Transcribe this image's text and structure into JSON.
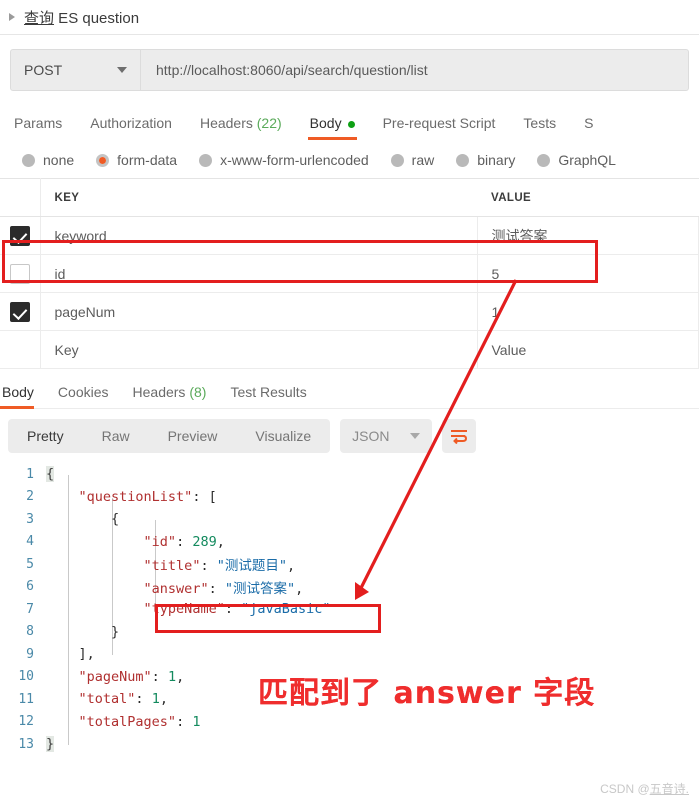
{
  "request": {
    "title_cn": "查询",
    "title_rest": " ES question",
    "method": "POST",
    "url": "http://localhost:8060/api/search/question/list",
    "tabs": [
      {
        "label": "Params",
        "active": false,
        "count": ""
      },
      {
        "label": "Authorization",
        "active": false,
        "count": ""
      },
      {
        "label": "Headers",
        "active": false,
        "count": "(22)"
      },
      {
        "label": "Body",
        "active": true,
        "count": ""
      },
      {
        "label": "Pre-request Script",
        "active": false,
        "count": ""
      },
      {
        "label": "Tests",
        "active": false,
        "count": ""
      },
      {
        "label": "S",
        "active": false,
        "count": ""
      }
    ],
    "body_types": [
      {
        "label": "none",
        "selected": false
      },
      {
        "label": "form-data",
        "selected": true
      },
      {
        "label": "x-www-form-urlencoded",
        "selected": false
      },
      {
        "label": "raw",
        "selected": false
      },
      {
        "label": "binary",
        "selected": false
      },
      {
        "label": "GraphQL",
        "selected": false
      }
    ],
    "table": {
      "headers": {
        "key": "KEY",
        "value": "VALUE"
      },
      "rows": [
        {
          "checked": true,
          "key": "keyword",
          "value": "测试答案",
          "placeholder": false
        },
        {
          "checked": false,
          "key": "id",
          "value": "5",
          "placeholder": false
        },
        {
          "checked": true,
          "key": "pageNum",
          "value": "1",
          "placeholder": false
        },
        {
          "checked": false,
          "key": "Key",
          "value": "Value",
          "placeholder": true
        }
      ]
    }
  },
  "response": {
    "tabs": [
      {
        "label": "Body",
        "active": true,
        "count": ""
      },
      {
        "label": "Cookies",
        "active": false,
        "count": ""
      },
      {
        "label": "Headers",
        "active": false,
        "count": "(8)"
      },
      {
        "label": "Test Results",
        "active": false,
        "count": ""
      }
    ],
    "view_modes": [
      {
        "label": "Pretty",
        "active": true
      },
      {
        "label": "Raw",
        "active": false
      },
      {
        "label": "Preview",
        "active": false
      },
      {
        "label": "Visualize",
        "active": false
      }
    ],
    "format": "JSON",
    "wrap_icon": "wrap-lines-icon",
    "code_lines": [
      {
        "n": "1",
        "segments": [
          {
            "t": "{",
            "c": "brc"
          }
        ]
      },
      {
        "n": "2",
        "segments": [
          {
            "t": "    ",
            "c": "pun"
          },
          {
            "t": "\"questionList\"",
            "c": "k"
          },
          {
            "t": ": [",
            "c": "pun"
          }
        ]
      },
      {
        "n": "3",
        "segments": [
          {
            "t": "        {",
            "c": "pun"
          }
        ]
      },
      {
        "n": "4",
        "segments": [
          {
            "t": "            ",
            "c": "pun"
          },
          {
            "t": "\"id\"",
            "c": "k"
          },
          {
            "t": ": ",
            "c": "pun"
          },
          {
            "t": "289",
            "c": "num"
          },
          {
            "t": ",",
            "c": "pun"
          }
        ]
      },
      {
        "n": "5",
        "segments": [
          {
            "t": "            ",
            "c": "pun"
          },
          {
            "t": "\"title\"",
            "c": "k"
          },
          {
            "t": ": ",
            "c": "pun"
          },
          {
            "t": "\"测试题目\"",
            "c": "str"
          },
          {
            "t": ",",
            "c": "pun"
          }
        ]
      },
      {
        "n": "6",
        "segments": [
          {
            "t": "            ",
            "c": "pun"
          },
          {
            "t": "\"answer\"",
            "c": "k"
          },
          {
            "t": ": ",
            "c": "pun"
          },
          {
            "t": "\"测试答案\"",
            "c": "str"
          },
          {
            "t": ",",
            "c": "pun"
          }
        ]
      },
      {
        "n": "7",
        "segments": [
          {
            "t": "            ",
            "c": "pun"
          },
          {
            "t": "\"typeName\"",
            "c": "k"
          },
          {
            "t": ": ",
            "c": "pun"
          },
          {
            "t": "\"javaBasic\"",
            "c": "str"
          }
        ]
      },
      {
        "n": "8",
        "segments": [
          {
            "t": "        }",
            "c": "pun"
          }
        ]
      },
      {
        "n": "9",
        "segments": [
          {
            "t": "    ],",
            "c": "pun"
          }
        ]
      },
      {
        "n": "10",
        "segments": [
          {
            "t": "    ",
            "c": "pun"
          },
          {
            "t": "\"pageNum\"",
            "c": "k"
          },
          {
            "t": ": ",
            "c": "pun"
          },
          {
            "t": "1",
            "c": "num"
          },
          {
            "t": ",",
            "c": "pun"
          }
        ]
      },
      {
        "n": "11",
        "segments": [
          {
            "t": "    ",
            "c": "pun"
          },
          {
            "t": "\"total\"",
            "c": "k"
          },
          {
            "t": ": ",
            "c": "pun"
          },
          {
            "t": "1",
            "c": "num"
          },
          {
            "t": ",",
            "c": "pun"
          }
        ]
      },
      {
        "n": "12",
        "segments": [
          {
            "t": "    ",
            "c": "pun"
          },
          {
            "t": "\"totalPages\"",
            "c": "k"
          },
          {
            "t": ": ",
            "c": "pun"
          },
          {
            "t": "1",
            "c": "num"
          }
        ]
      },
      {
        "n": "13",
        "segments": [
          {
            "t": "}",
            "c": "brc"
          }
        ]
      }
    ]
  },
  "annotations": {
    "callout_text": "匹配到了 answer 字段",
    "highlight_color": "#e31e1e"
  },
  "watermark": {
    "prefix": "CSDN @",
    "author": "五音诗."
  }
}
